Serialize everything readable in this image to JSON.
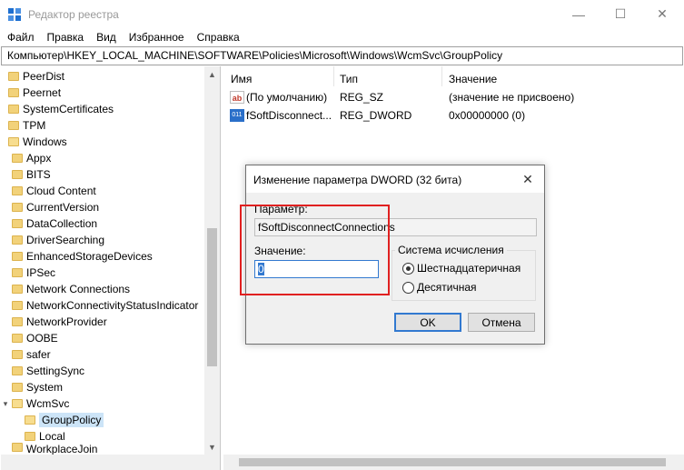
{
  "window": {
    "title": "Редактор реестра",
    "min_glyph": "—",
    "max_glyph": "☐",
    "close_glyph": "✕"
  },
  "menu": {
    "items": [
      "Файл",
      "Правка",
      "Вид",
      "Избранное",
      "Справка"
    ]
  },
  "address": {
    "path": "Компьютер\\HKEY_LOCAL_MACHINE\\SOFTWARE\\Policies\\Microsoft\\Windows\\WcmSvc\\GroupPolicy"
  },
  "tree": {
    "items": [
      {
        "label": "PeerDist"
      },
      {
        "label": "Peernet"
      },
      {
        "label": "SystemCertificates"
      },
      {
        "label": "TPM"
      },
      {
        "label": "Windows"
      },
      {
        "label": "Appx"
      },
      {
        "label": "BITS"
      },
      {
        "label": "Cloud Content"
      },
      {
        "label": "CurrentVersion"
      },
      {
        "label": "DataCollection"
      },
      {
        "label": "DriverSearching"
      },
      {
        "label": "EnhancedStorageDevices"
      },
      {
        "label": "IPSec"
      },
      {
        "label": "Network Connections"
      },
      {
        "label": "NetworkConnectivityStatusIndicator"
      },
      {
        "label": "NetworkProvider"
      },
      {
        "label": "OOBE"
      },
      {
        "label": "safer"
      },
      {
        "label": "SettingSync"
      },
      {
        "label": "System"
      },
      {
        "label": "WcmSvc"
      },
      {
        "label": "GroupPolicy"
      },
      {
        "label": "Local"
      },
      {
        "label": "WorkplaceJoin"
      }
    ],
    "selected": "GroupPolicy"
  },
  "values": {
    "columns": {
      "name": "Имя",
      "type": "Тип",
      "data": "Значение"
    },
    "rows": [
      {
        "name": "(По умолчанию)",
        "type": "REG_SZ",
        "data": "(значение не присвоено)",
        "icon": "string-value-icon"
      },
      {
        "name": "fSoftDisconnect...",
        "type": "REG_DWORD",
        "data": "0x00000000 (0)",
        "icon": "binary-value-icon"
      }
    ]
  },
  "dialog": {
    "title": "Изменение параметра DWORD (32 бита)",
    "param_label": "Параметр:",
    "param_value": "fSoftDisconnectConnections",
    "value_label": "Значение:",
    "value": "0",
    "base_label": "Система исчисления",
    "radio_hex": "Шестнадцатеричная",
    "radio_dec": "Десятичная",
    "selected_base": "hex",
    "ok_label": "OK",
    "cancel_label": "Отмена"
  },
  "colors": {
    "accent": "#3279d0",
    "highlight": "#e02020",
    "folder": "#f2d27a"
  }
}
